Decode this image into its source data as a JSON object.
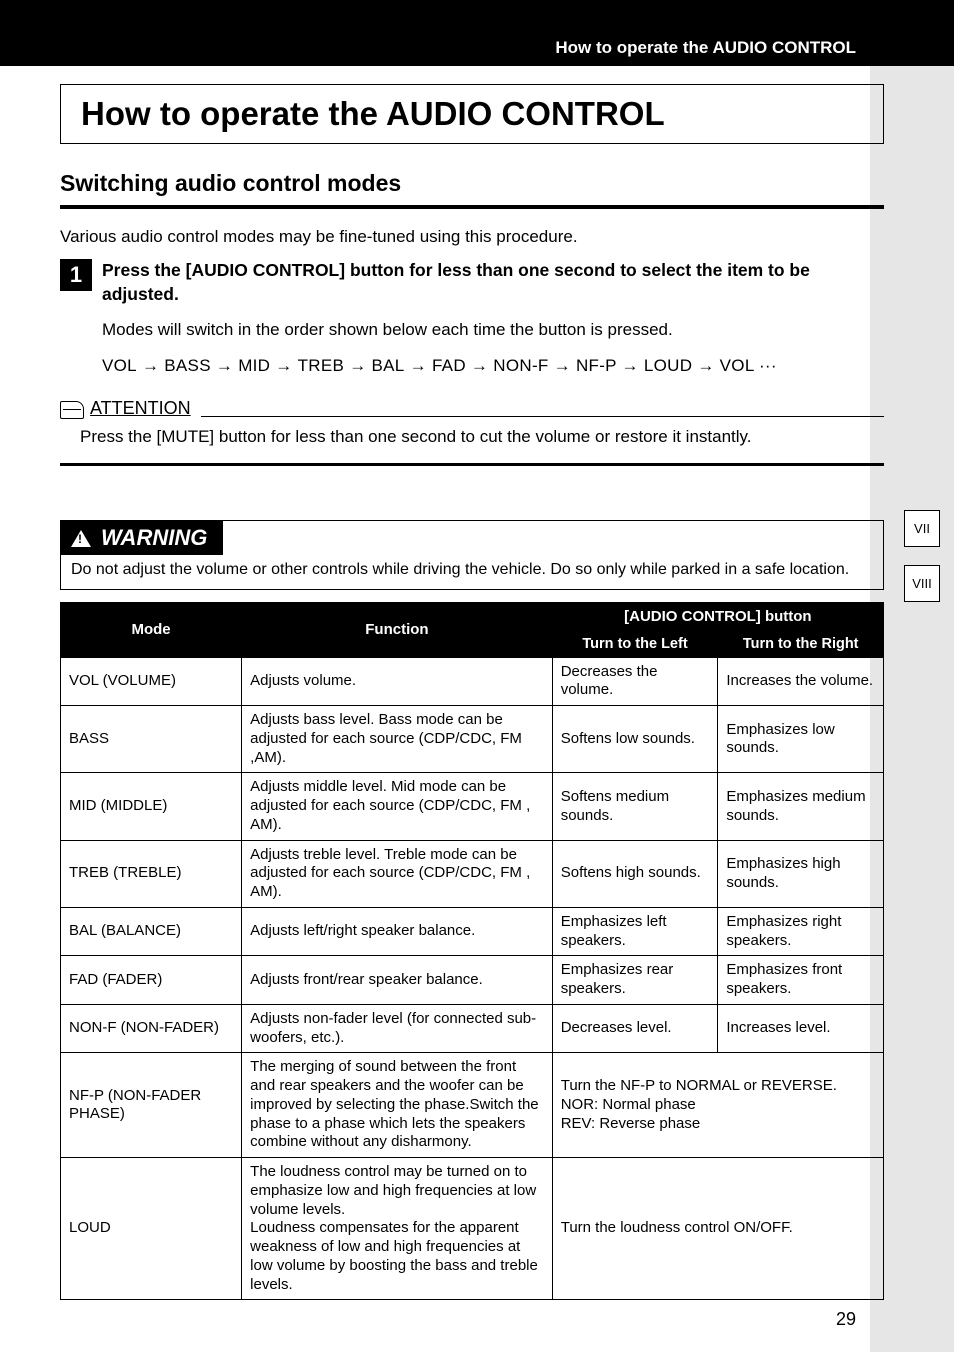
{
  "breadcrumb": "How to operate the AUDIO CONTROL",
  "title": "How to operate the AUDIO CONTROL",
  "section": "Switching audio control modes",
  "intro": "Various audio control modes may be fine-tuned using this procedure.",
  "step": {
    "num": "1",
    "head": "Press the [AUDIO CONTROL] button for less than one second to select the item to be adjusted.",
    "text": "Modes will switch in the order shown below each time the button is pressed.",
    "seq": [
      "VOL",
      "BASS",
      "MID",
      "TREB",
      "BAL",
      "FAD",
      "NON-F",
      "NF-P ",
      "LOUD",
      "VOL ···"
    ]
  },
  "attention": {
    "label": "ATTENTION",
    "text": "Press the [MUTE] button for less than one second to cut the volume or restore it instantly."
  },
  "warning": {
    "label": "WARNING",
    "text": "Do not adjust the volume or other controls while driving the vehicle. Do so only while parked in a safe location."
  },
  "table": {
    "head": {
      "mode": "Mode",
      "func": "Function",
      "group": "[AUDIO CONTROL] button",
      "left": "Turn to the Left",
      "right": "Turn to the Right"
    },
    "rows": [
      {
        "mode": "VOL (VOLUME)",
        "func": "Adjusts volume.",
        "left": "Decreases the volume.",
        "right": "Increases the volume."
      },
      {
        "mode": "BASS",
        "func": "Adjusts bass level. Bass mode can be adjusted for each source (CDP/CDC, FM ,AM).",
        "left": "Softens low sounds.",
        "right": "Emphasizes low sounds."
      },
      {
        "mode": "MID (MIDDLE)",
        "func": "Adjusts middle level. Mid mode can be adjusted for each source (CDP/CDC, FM , AM).",
        "left": "Softens medium sounds.",
        "right": "Emphasizes medium sounds."
      },
      {
        "mode": "TREB (TREBLE)",
        "func": "Adjusts treble level. Treble mode can be adjusted for each source (CDP/CDC, FM , AM).",
        "left": "Softens high sounds.",
        "right": "Emphasizes high sounds."
      },
      {
        "mode": "BAL (BALANCE)",
        "func": "Adjusts left/right speaker balance.",
        "left": "Emphasizes left speakers.",
        "right": "Emphasizes right speakers."
      },
      {
        "mode": "FAD (FADER)",
        "func": "Adjusts front/rear speaker balance.",
        "left": "Emphasizes rear speakers.",
        "right": "Emphasizes front speakers."
      },
      {
        "mode": "NON-F (NON-FADER)",
        "func": "Adjusts non-fader level (for connected sub-woofers, etc.).",
        "left": "Decreases level.",
        "right": "Increases level."
      },
      {
        "mode": "NF-P (NON-FADER PHASE)",
        "func": "The merging of sound between the front and rear speakers and the woofer can be improved by selecting the phase.Switch the phase to a phase which lets the speakers combine without any disharmony.",
        "merged": "Turn the NF-P to NORMAL or REVERSE.\nNOR: Normal phase\nREV: Reverse phase"
      },
      {
        "mode": "LOUD",
        "func": "The loudness control may be turned on to emphasize low and high frequencies at low volume levels.\nLoudness compensates for the apparent weakness of low and high frequencies at low volume by boosting the bass and treble levels.",
        "merged": "Turn the loudness control ON/OFF."
      }
    ]
  },
  "tabs": [
    "VII",
    "VIII"
  ],
  "page": "29"
}
